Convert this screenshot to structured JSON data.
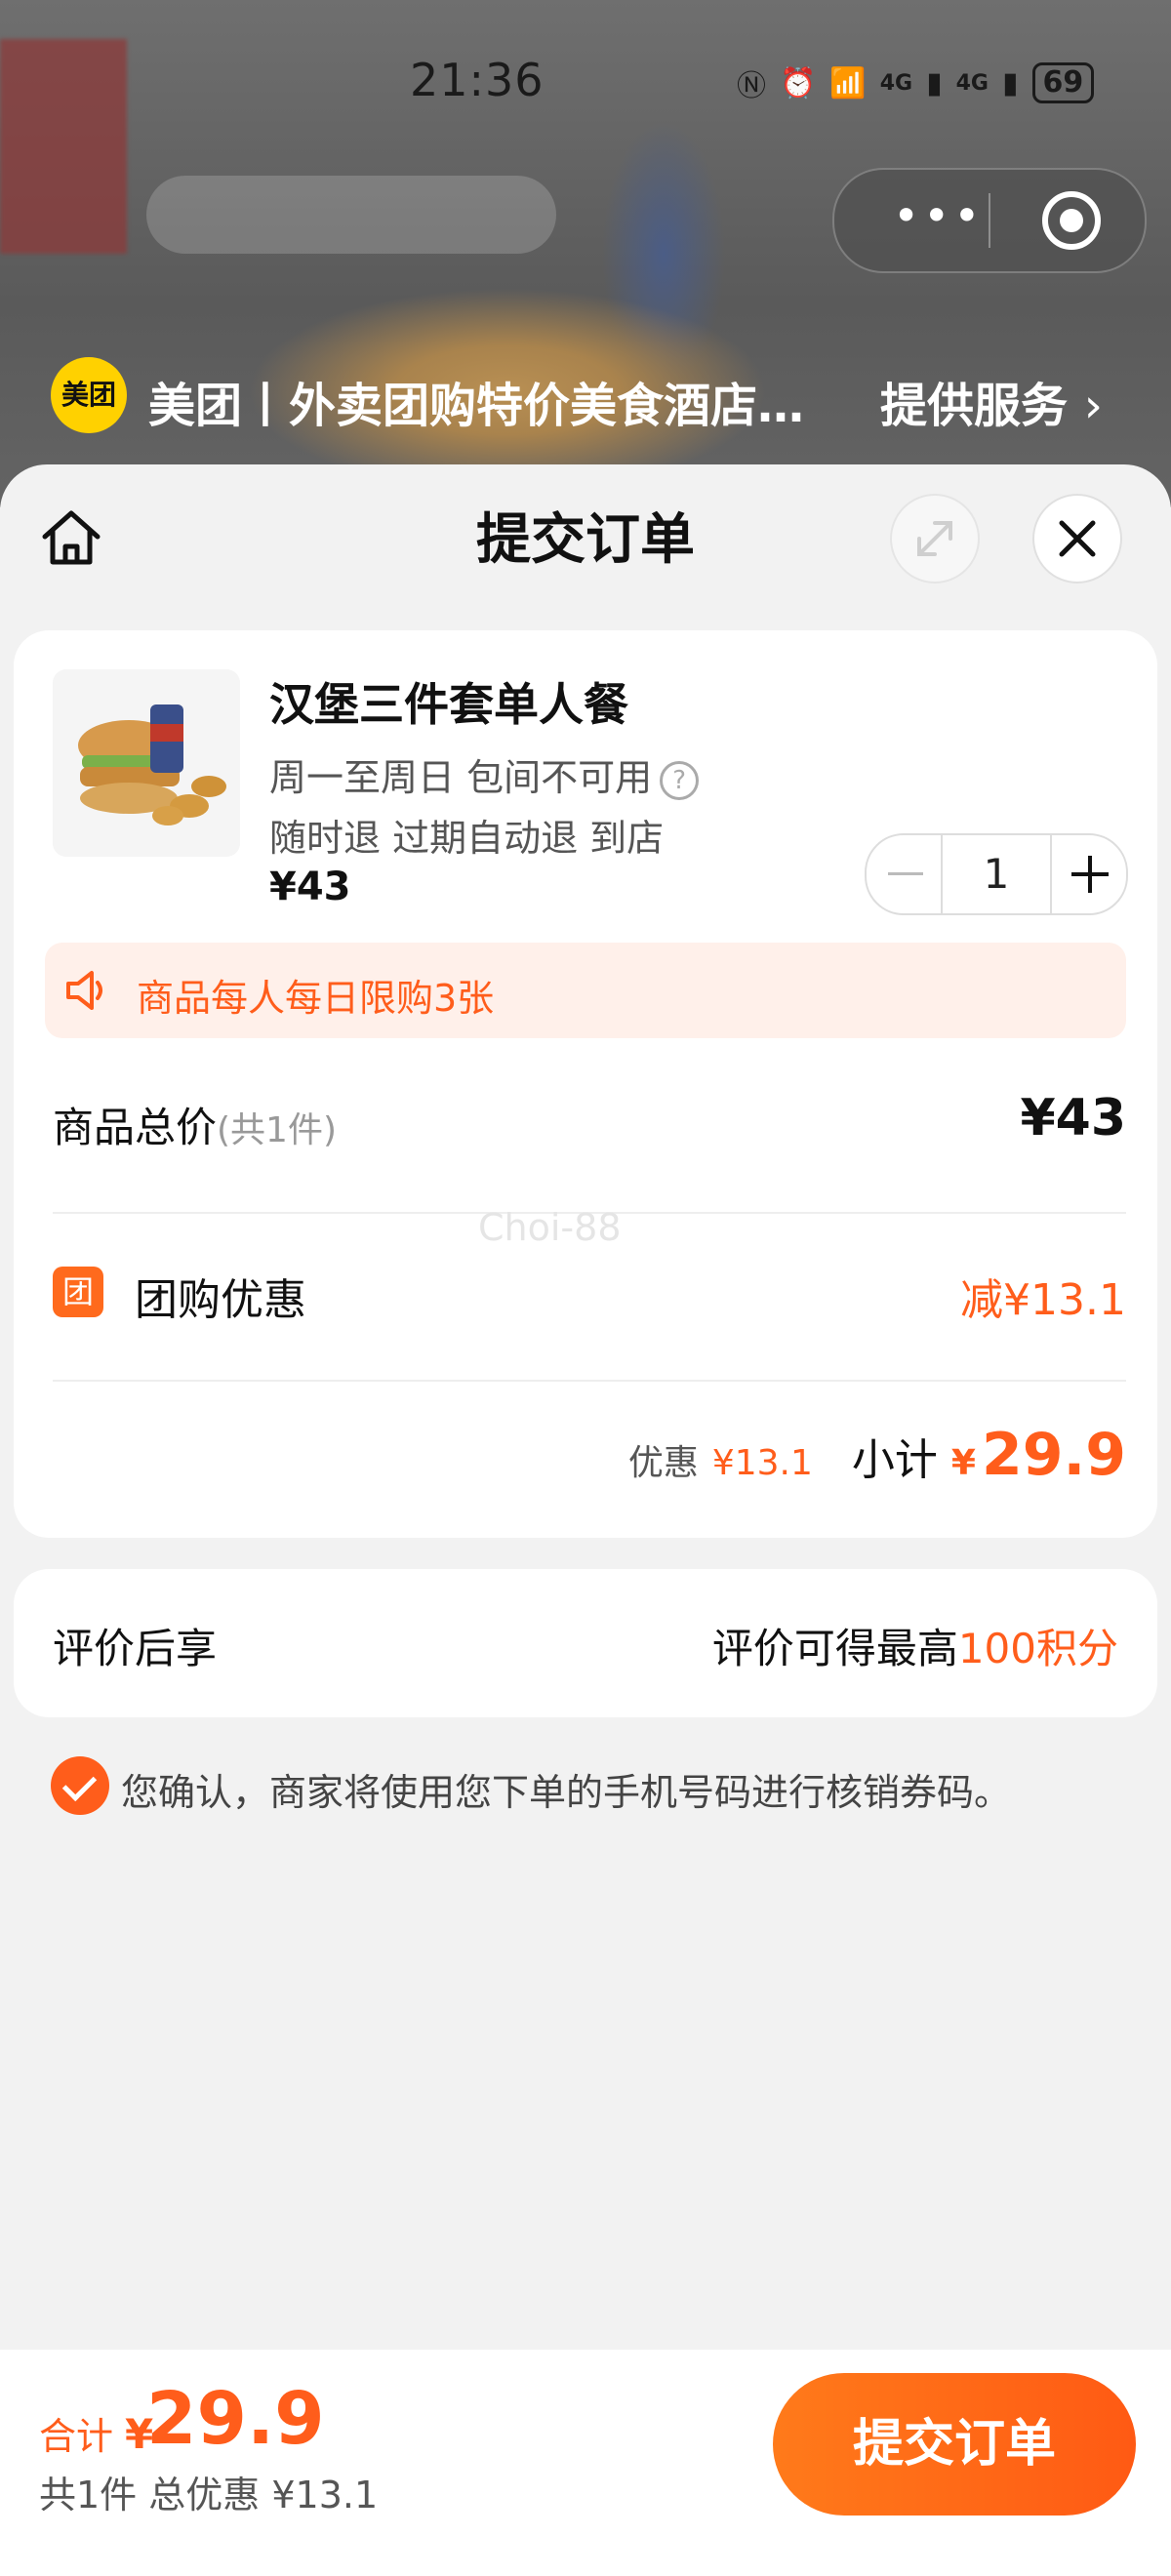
{
  "status_bar": {
    "time": "21:36",
    "battery": "69",
    "network_label_1": "4G",
    "network_label_2": "4G"
  },
  "mini_program": {
    "logo_text": "美团",
    "title": "美团丨外卖团购特价美食酒店…",
    "service_link": "提供服务"
  },
  "sheet": {
    "title": "提交订单"
  },
  "product": {
    "name": "汉堡三件套单人餐",
    "line1": "周一至周日 包间不可用",
    "line2": "随时退 过期自动退 到店",
    "price": "¥43",
    "quantity": "1",
    "help_glyph": "?"
  },
  "limit_notice": "商品每人每日限购3张",
  "order_total": {
    "label": "商品总价",
    "sub": "(共1件)",
    "value": "¥43"
  },
  "watermark": "Choi-88",
  "group_discount": {
    "badge": "团",
    "label": "团购优惠",
    "value": "减¥13.1"
  },
  "subtotal": {
    "discount_label": "优惠",
    "discount_value": "¥13.1",
    "label": "小计",
    "currency": "¥",
    "value": "29.9"
  },
  "review": {
    "label": "评价后享",
    "text": "评价可得最高",
    "points": "100积分"
  },
  "confirm_text": "您确认，商家将使用您下单的手机号码进行核销券码。",
  "bottom": {
    "total_label": "合计",
    "currency": "¥",
    "total_value": "29.9",
    "summary": "共1件 总优惠 ¥13.1",
    "submit_label": "提交订单"
  },
  "colors": {
    "accent": "#ff5d1b",
    "notice_bg": "#fff0ea",
    "page_bg": "#f2f2f2"
  },
  "icons": [
    "home-icon",
    "expand-icon",
    "close-icon",
    "speaker-icon",
    "help-icon",
    "check-icon",
    "chevron-right-icon",
    "more-dots-icon",
    "target-icon"
  ]
}
